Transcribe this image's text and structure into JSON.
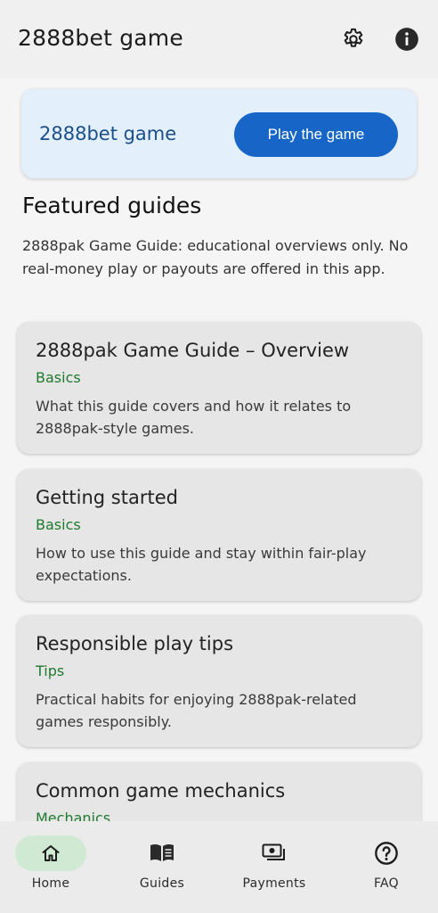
{
  "topbar": {
    "title": "2888bet game",
    "settings_icon": "gear-icon",
    "info_icon": "info-icon"
  },
  "banner": {
    "title": "2888bet game",
    "button_label": "Play the game"
  },
  "featured": {
    "title": "Featured guides",
    "description": "2888pak Game Guide: educational overviews only. No real-money play or payouts are offered in this app."
  },
  "cards": [
    {
      "title": "2888pak Game Guide – Overview",
      "tag": "Basics",
      "description": "What this guide covers and how it relates to 2888pak-style games."
    },
    {
      "title": "Getting started",
      "tag": "Basics",
      "description": "How to use this guide and stay within fair-play expectations."
    },
    {
      "title": "Responsible play tips",
      "tag": "Tips",
      "description": "Practical habits for enjoying 2888pak-related games responsibly."
    },
    {
      "title": "Common game mechanics",
      "tag": "Mechanics",
      "description": ""
    }
  ],
  "nav": [
    {
      "label": "Home",
      "icon": "home-icon",
      "active": true
    },
    {
      "label": "Guides",
      "icon": "book-icon",
      "active": false
    },
    {
      "label": "Payments",
      "icon": "payments-icon",
      "active": false
    },
    {
      "label": "FAQ",
      "icon": "help-icon",
      "active": false
    }
  ],
  "colors": {
    "accent": "#1766c7",
    "tag_green": "#1f7a2e",
    "banner_bg": "#e3effb",
    "nav_active": "#cfe9d2"
  }
}
